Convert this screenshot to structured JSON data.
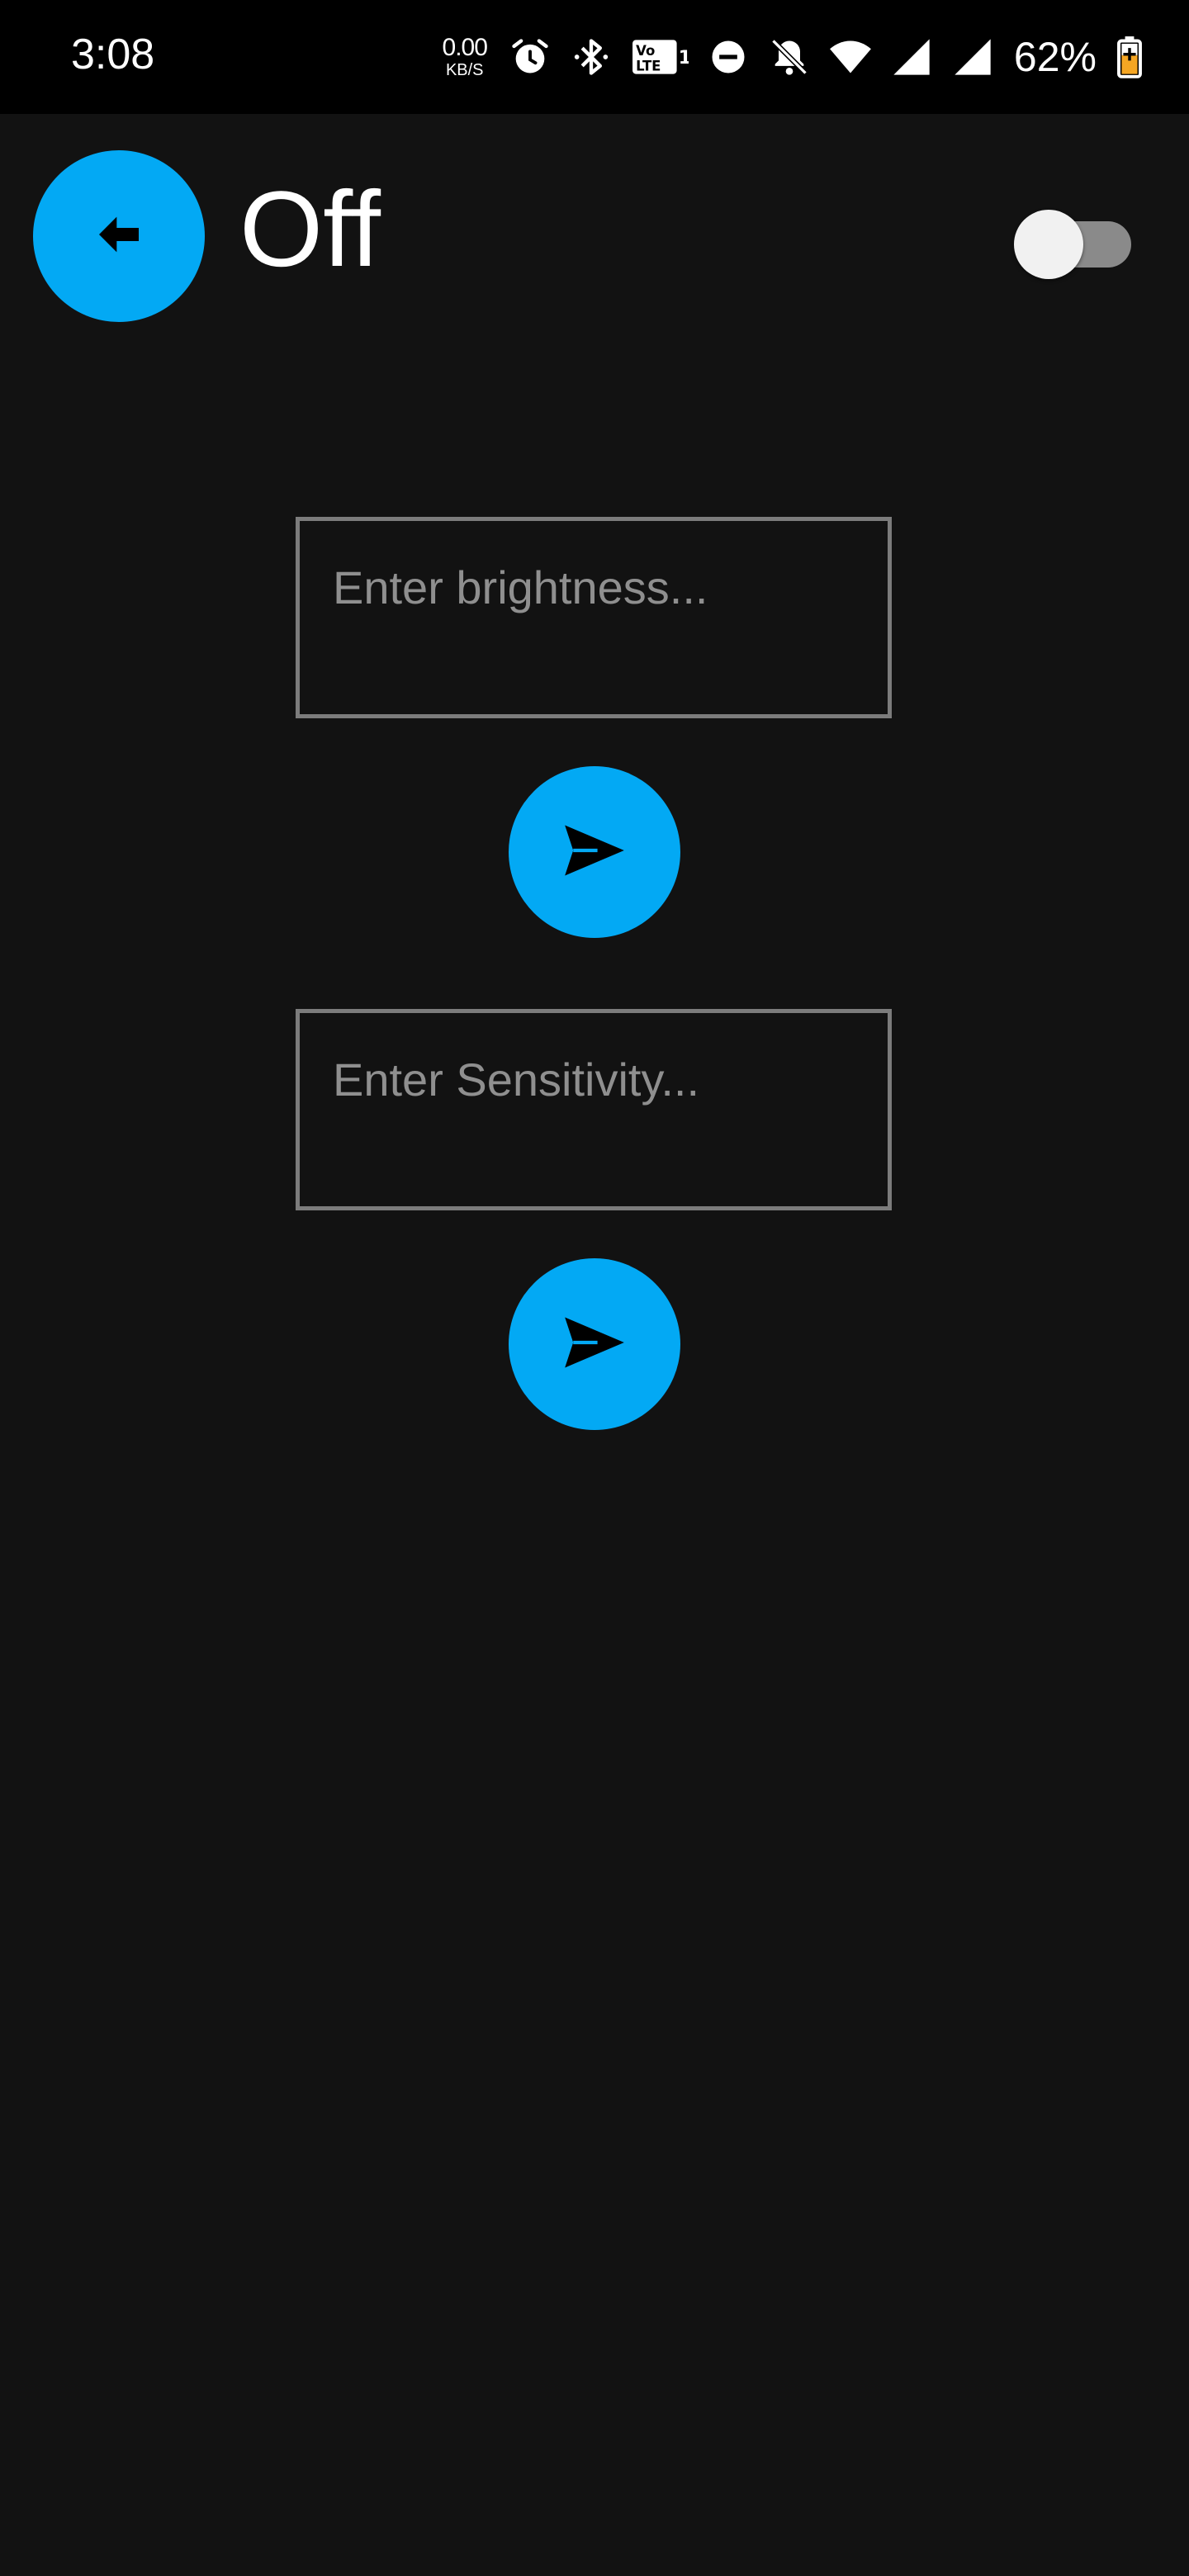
{
  "status_bar": {
    "time": "3:08",
    "net_speed_value": "0.00",
    "net_speed_unit": "KB/S",
    "battery_percent": "62%",
    "icons": [
      "alarm-icon",
      "bluetooth-icon",
      "volte-icon",
      "dnd-icon",
      "notifications-off-icon",
      "wifi-icon",
      "signal-icon",
      "signal-icon",
      "battery-charging-icon"
    ]
  },
  "header": {
    "title": "Off",
    "back_icon": "arrow-back-icon",
    "toggle_on": false
  },
  "form": {
    "brightness_placeholder": "Enter brightness...",
    "brightness_value": "",
    "sensitivity_placeholder": "Enter Sensitivity...",
    "sensitivity_value": "",
    "send_icon": "send-icon"
  },
  "colors": {
    "accent": "#03a9f4",
    "background": "#121212",
    "status_bar": "#000000"
  }
}
